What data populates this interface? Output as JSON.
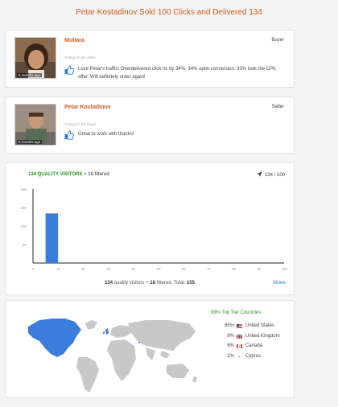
{
  "page": {
    "title": "Petar Kostadinov Sold 100 Clicks and Delivered 134"
  },
  "reviews": [
    {
      "name": "Mutiara",
      "role": "Buyer",
      "ago": "6 months ago",
      "rating_label": "Rating for the seller",
      "text": "Love Petar's traffic! Overdelivered click #s by 34%. 34% optin conversion. 33% took the CPA offer. Will definitely order again!"
    },
    {
      "name": "Petar Kostadinov",
      "role": "Seller",
      "ago": "6 months ago",
      "rating_label": "Rating for the buyer",
      "text": "Great to work with thanks!"
    }
  ],
  "stats": {
    "quality_label": "134 QUALITY VISITORS",
    "filtered_label": "+ 18 filtered",
    "count": "134 / 100",
    "summary": {
      "quality_num": "134",
      "quality_text": "quality visitors",
      "plus": "+",
      "filtered_num": "18",
      "filtered_text": "filtered.",
      "total_label": "Total:",
      "total": "155"
    },
    "share_label": "Share"
  },
  "chart_data": {
    "type": "bar",
    "x_ticks": [
      "0",
      "10",
      "20",
      "30",
      "40",
      "50",
      "60",
      "70",
      "80",
      "90",
      "100"
    ],
    "y_ticks": [
      "200",
      "150",
      "100",
      "50"
    ],
    "xlim": [
      0,
      100
    ],
    "ylim": [
      0,
      200
    ],
    "bars": [
      {
        "x_start": 5,
        "x_end": 10,
        "value": 134
      }
    ],
    "bar_color": "#3b7ddd"
  },
  "geo": {
    "top_tier": "99% Top Tier Countries",
    "countries": [
      {
        "pct": "85%",
        "name": "United States",
        "flag": "us"
      },
      {
        "pct": "8%",
        "name": "United Kingdom",
        "flag": "gb"
      },
      {
        "pct": "6%",
        "name": "Canada",
        "flag": "ca"
      },
      {
        "pct": "1%",
        "name": "Cyprus",
        "flag": "cy"
      }
    ],
    "highlight_color": "#3b7ddd",
    "base_color": "#c8c8c8"
  }
}
